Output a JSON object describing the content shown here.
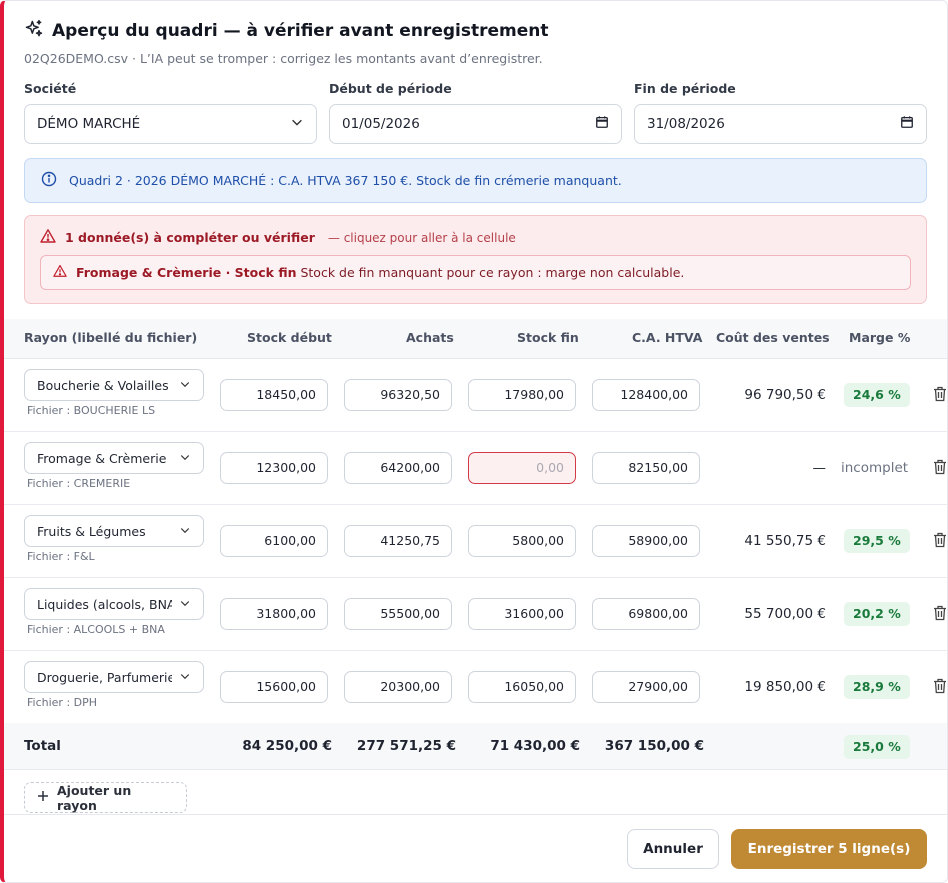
{
  "header": {
    "title": "Aperçu du quadri — à vérifier avant enregistrement",
    "subtitle": "02Q26DEMO.csv · L’IA peut se tromper : corrigez les montants avant d’enregistrer."
  },
  "fields": {
    "societe_label": "Société",
    "societe_value": "DÉMO MARCHÉ",
    "debut_label": "Début de période",
    "debut_value": "01/05/2026",
    "fin_label": "Fin de période",
    "fin_value": "31/08/2026"
  },
  "info": {
    "text": "Quadri 2 · 2026 DÉMO MARCHÉ : C.A. HTVA 367 150 €. Stock de fin crémerie manquant."
  },
  "alert": {
    "title": "1 donnée(s) à compléter ou vérifier",
    "hint": "— cliquez pour aller à la cellule",
    "item_bold": "Fromage & Crèmerie · Stock fin",
    "item_text": "Stock de fin manquant pour ce rayon : marge non calculable."
  },
  "table": {
    "headers": {
      "rayon": "Rayon (libellé du fichier)",
      "stock_debut": "Stock début",
      "achats": "Achats",
      "stock_fin": "Stock fin",
      "ca": "C.A. HTVA",
      "cout": "Coût des ventes",
      "marge": "Marge %"
    },
    "rows": [
      {
        "rayon": "Boucherie & Volailles",
        "fichier": "Fichier : BOUCHERIE LS",
        "stock_debut": "18450,00",
        "achats": "96320,50",
        "stock_fin": "17980,00",
        "ca": "128400,00",
        "cout": "96 790,50 €",
        "marge": "24,6 %"
      },
      {
        "rayon": "Fromage & Crèmerie",
        "fichier": "Fichier : CREMERIE",
        "stock_debut": "12300,00",
        "achats": "64200,00",
        "stock_fin": "0,00",
        "ca": "82150,00",
        "cout": "—",
        "marge": "incomplet"
      },
      {
        "rayon": "Fruits & Légumes",
        "fichier": "Fichier : F&L",
        "stock_debut": "6100,00",
        "achats": "41250,75",
        "stock_fin": "5800,00",
        "ca": "58900,00",
        "cout": "41 550,75 €",
        "marge": "29,5 %"
      },
      {
        "rayon": "Liquides (alcools, BNA",
        "fichier": "Fichier : ALCOOLS + BNA",
        "stock_debut": "31800,00",
        "achats": "55500,00",
        "stock_fin": "31600,00",
        "ca": "69800,00",
        "cout": "55 700,00 €",
        "marge": "20,2 %"
      },
      {
        "rayon": "Droguerie, Parfumerie",
        "fichier": "Fichier : DPH",
        "stock_debut": "15600,00",
        "achats": "20300,00",
        "stock_fin": "16050,00",
        "ca": "27900,00",
        "cout": "19 850,00 €",
        "marge": "28,9 %"
      }
    ],
    "total": {
      "label": "Total",
      "stock_debut": "84 250,00 €",
      "achats": "277 571,25 €",
      "stock_fin": "71 430,00 €",
      "ca": "367 150,00 €",
      "marge": "25,0 %"
    }
  },
  "actions": {
    "add_rayon": "Ajouter un rayon",
    "cancel": "Annuler",
    "save": "Enregistrer 5 ligne(s)"
  },
  "colors": {
    "accent": "#c08a35",
    "error": "#e0183c",
    "info": "#1f4fa8",
    "success": "#1a7a3c"
  }
}
